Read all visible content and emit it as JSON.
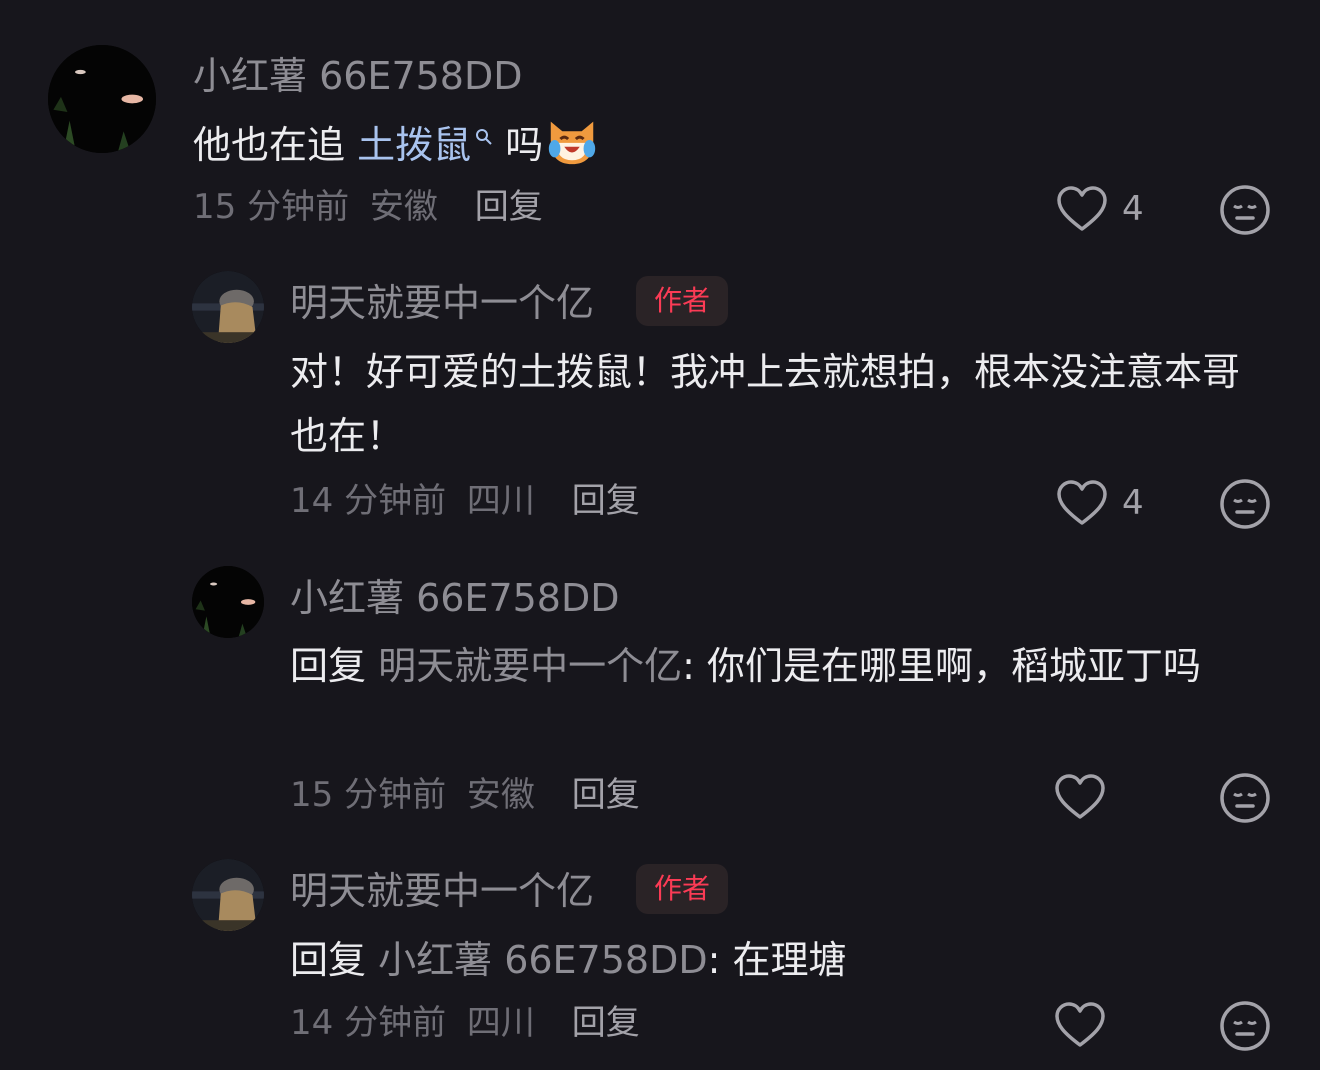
{
  "comments": [
    {
      "username": "小红薯 66E758DD",
      "text_main": "他也在追 ",
      "text_link": "土拨鼠",
      "text_end": " 吗",
      "time": "15 分钟前",
      "location": "安徽",
      "reply_label": "回复",
      "likes": "4"
    },
    {
      "username": "明天就要中一个亿",
      "badge": "作者",
      "text": "对！好可爱的土拨鼠！我冲上去就想拍，根本没注意本哥也在！",
      "time": "14 分钟前",
      "location": "四川",
      "reply_label": "回复",
      "likes": "4"
    },
    {
      "username": "小红薯 66E758DD",
      "reply_prefix": "回复",
      "reply_target": "明天就要中一个亿",
      "text": ": 你们是在哪里啊，稻城亚丁吗",
      "time": "15 分钟前",
      "location": "安徽",
      "reply_label": "回复"
    },
    {
      "username": "明天就要中一个亿",
      "badge": "作者",
      "reply_prefix": "回复",
      "reply_target": "小红薯 66E758DD",
      "text": ": 在理塘",
      "time": "14 分钟前",
      "location": "四川",
      "reply_label": "回复"
    }
  ],
  "icons": {
    "like": "heart-outline-icon",
    "react": "neutral-face-icon",
    "emoji": "laughing-cat-emoji"
  },
  "colors": {
    "background": "#17161c",
    "author_badge": "#fb3b55",
    "link": "#a9c3ee"
  }
}
